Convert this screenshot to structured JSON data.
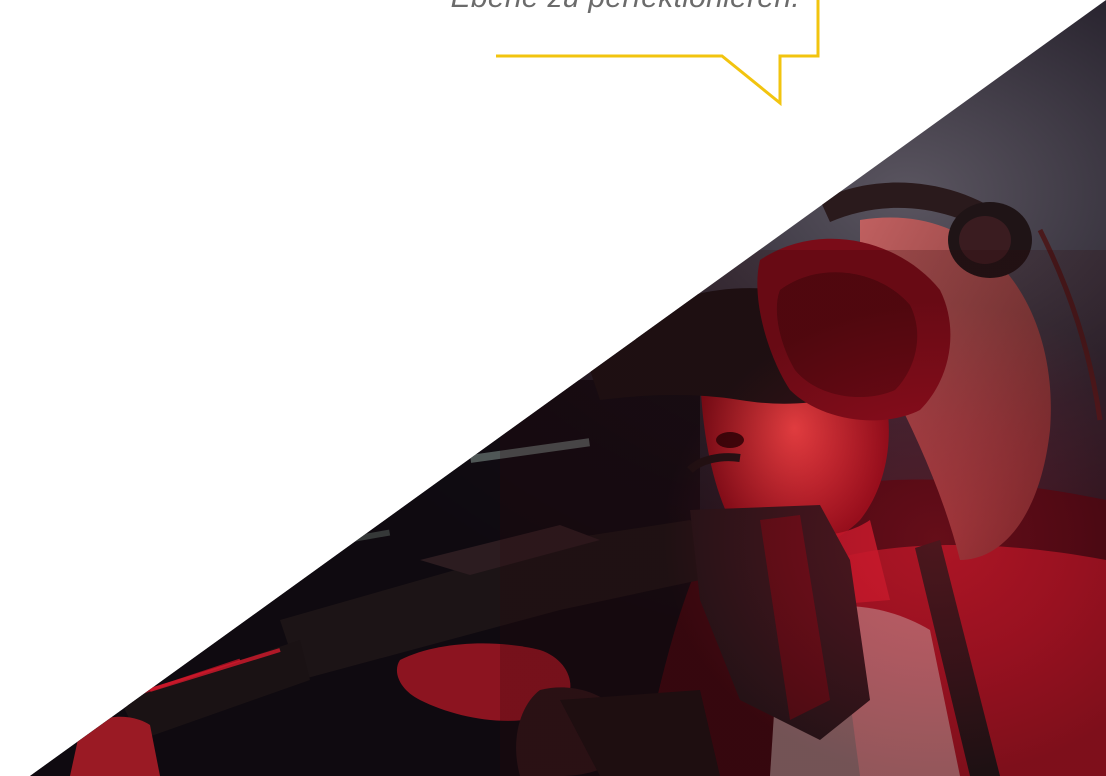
{
  "quote": {
    "text": "Ebene zu perfektionieren."
  },
  "colors": {
    "accent": "#f2c40f",
    "text": "#6b6b6b",
    "photo_red": "#e0122a",
    "photo_dark": "#120c14"
  },
  "photo": {
    "icon": "vr-headset-player-photo"
  }
}
